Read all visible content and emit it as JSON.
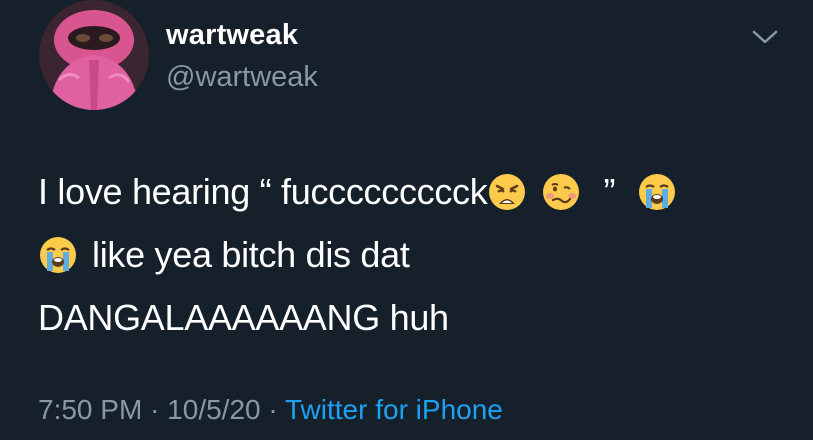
{
  "colors": {
    "background": "#15202b",
    "text_primary": "#ffffff",
    "text_secondary": "#8899a6",
    "link": "#1da1f2"
  },
  "user": {
    "display_name": "wartweak",
    "handle": "@wartweak",
    "avatar_icon": "avatar-pink-hoodie"
  },
  "tweet": {
    "line1": {
      "text_a": "I love hearing “ fuccccccccck",
      "emoji_1": "weary-face-emoji",
      "emoji_2": "woozy-face-emoji",
      "text_b": "”",
      "emoji_3": "loudly-crying-face-emoji"
    },
    "line2": {
      "emoji_1": "loudly-crying-face-emoji",
      "text": "like yea bitch dis dat"
    },
    "line3": {
      "text": "DANGALAAAAAANG huh"
    }
  },
  "meta": {
    "time": "7:50 PM",
    "separator_1": "·",
    "date": "10/5/20",
    "separator_2": "·",
    "source": "Twitter for iPhone"
  },
  "menu": {
    "icon": "chevron-down-icon"
  }
}
